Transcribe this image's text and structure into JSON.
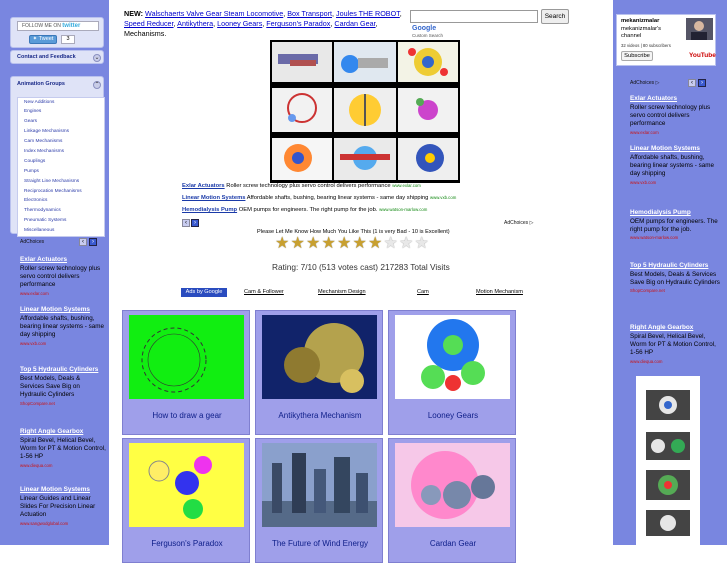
{
  "left_sidebar": {
    "follow_label": "FOLLOW ME ON",
    "twitter_word": "twitter",
    "tweet_label": "Tweet",
    "tweet_count": "3",
    "contact_label": "Contact and Feedback",
    "animation_groups_title": "Animation Groups",
    "groups": [
      "New Additions",
      "Engines",
      "Gears",
      "Linkage Mechanisms",
      "Cam Mechanisms",
      "Index Mechanisms",
      "Couplings",
      "Pumps",
      "Straight Line Mechanisms",
      "Reciprocation Mechanisms",
      "Electronics",
      "Thermodynamics",
      "Pneumatic Systems",
      "Miscellaneous"
    ],
    "adchoices": "AdChoices",
    "ads": [
      {
        "title": "Exlar Actuators",
        "desc": "Roller screw technology plus servo control delivers performance",
        "url": "www.exlar.com"
      },
      {
        "title": "Linear Motion Systems",
        "desc": "Affordable shafts, bushing, bearing linear systems - same day shipping",
        "url": "www.vxb.com"
      },
      {
        "title": "Top 5 Hydraulic Cylinders",
        "desc": "Best Models, Deals & Services Save Big on Hydraulic Cylinders",
        "url": "ShopCompare.net"
      },
      {
        "title": "Right Angle Gearbox",
        "desc": "Spiral Bevel, Helical Bevel, Worm for PT & Motion Control, 1-56 HP",
        "url": "www.diequa.com"
      },
      {
        "title": "Linear Motion Systems",
        "desc": "Linear Guides and Linear Slides For Precision Linear Actuation",
        "url": "www.sangwodglobal.com"
      }
    ]
  },
  "header": {
    "new_label": "NEW:",
    "links": [
      "Walschaerts Valve Gear Steam Locomotive",
      "Box Transport",
      "Joules THE ROBOT",
      "Speed Reducer",
      "Antikythera",
      "Looney Gears",
      "Ferguson's Paradox",
      "Cardan Gear"
    ],
    "suffix": "Mechanisms.",
    "search_button": "Search",
    "google_label": "Google",
    "custom_search": "Custom Search"
  },
  "sponsored": [
    {
      "title": "Exlar Actuators",
      "desc": "Roller screw technology plus servo control delivers performance",
      "url": "www.exlar.com"
    },
    {
      "title": "Linear Motion Systems",
      "desc": "Affordable shafts, bushing, bearing linear systems - same day shipping",
      "url": "www.vxb.com"
    },
    {
      "title": "Hemodialysis Pump",
      "desc": "OEM pumps for engineers. The right pump for the job.",
      "url": "www.watson-marlow.com"
    }
  ],
  "center_adchoices": "AdChoices",
  "rating": {
    "prompt": "Please Let Me Know How Much You Like This (1 is very Bad - 10 is Excellent)",
    "filled_stars": 7,
    "total_stars": 10,
    "text": "Rating: 7/10 (513 votes cast) 217283 Total Visits"
  },
  "ad_links": {
    "ads_by_google": "Ads by Google",
    "items": [
      "Cam & Follower",
      "Mechanism Design",
      "Cam",
      "Motion Mechanism"
    ]
  },
  "tiles": [
    "How to draw a gear",
    "Antikythera Mechanism",
    "Looney Gears",
    "Ferguson's Paradox",
    "The Future of Wind Energy",
    "Cardan Gear"
  ],
  "right_sidebar": {
    "channel_name": "mekanizmalar",
    "channel_line": "mekanizmalar's channel",
    "stats": "32 videos | 80 subscribers",
    "subscribe": "Subscribe",
    "youtube": "YouTube",
    "adchoices": "AdChoices",
    "ads": [
      {
        "title": "Exlar Actuators",
        "desc": "Roller screw technology plus servo control delivers performance",
        "url": "www.exlar.com"
      },
      {
        "title": "Linear Motion Systems",
        "desc": "Affordable shafts, bushing, bearing linear systems - same day shipping",
        "url": "www.vxb.com"
      },
      {
        "title": "Hemodialysis Pump",
        "desc": "OEM pumps for engineers. The right pump for the job.",
        "url": "www.watson-marlow.com"
      },
      {
        "title": "Top 5 Hydraulic Cylinders",
        "desc": "Best Models, Deals & Services Save Big on Hydraulic Cylinders",
        "url": "ShopCompare.net"
      },
      {
        "title": "Right Angle Gearbox",
        "desc": "Spiral Bevel, Helical Bevel, Worm for PT & Motion Control, 1-56 HP",
        "url": "www.diequa.com"
      }
    ]
  },
  "colors": {
    "sidebar": "#7986e0",
    "tile": "#9f9fea",
    "link": "#0000cc",
    "ad_url": "#cc1111"
  }
}
